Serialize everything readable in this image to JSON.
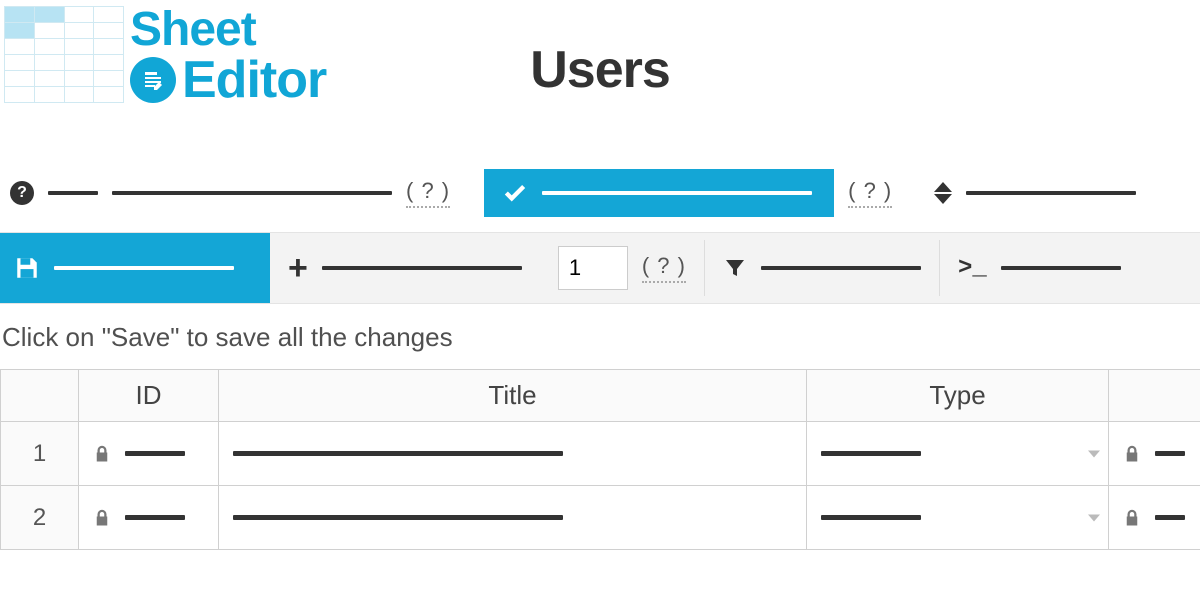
{
  "brand": {
    "line1": "Sheet",
    "line2": "Editor"
  },
  "page_title": "Users",
  "toolbar1": {
    "help_glyph": "?",
    "hint1": "( ? )",
    "hint2": "( ? )"
  },
  "toolbar2": {
    "page_value": "1",
    "page_hint": "( ? )",
    "console_glyph": ">_"
  },
  "hint_text": "Click on \"Save\" to save all the changes",
  "table": {
    "headers": {
      "id": "ID",
      "title": "Title",
      "type": "Type"
    },
    "rows": [
      {
        "num": "1"
      },
      {
        "num": "2"
      }
    ]
  },
  "colors": {
    "brand": "#14a6d6"
  }
}
